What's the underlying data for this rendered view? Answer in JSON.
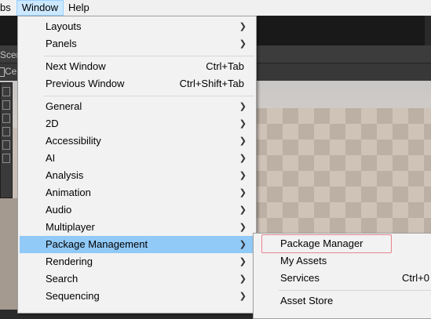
{
  "menubar": {
    "items": [
      {
        "label": "bs"
      },
      {
        "label": "Window"
      },
      {
        "label": "Help"
      }
    ]
  },
  "editor": {
    "scene_tab": "Scen",
    "subbar_text": "Ce"
  },
  "window_menu": {
    "items": [
      {
        "label": "Layouts",
        "submenu": true
      },
      {
        "label": "Panels",
        "submenu": true
      },
      {
        "label": "Next Window",
        "shortcut": "Ctrl+Tab"
      },
      {
        "label": "Previous Window",
        "shortcut": "Ctrl+Shift+Tab"
      },
      {
        "label": "General",
        "submenu": true
      },
      {
        "label": "2D",
        "submenu": true
      },
      {
        "label": "Accessibility",
        "submenu": true
      },
      {
        "label": "AI",
        "submenu": true
      },
      {
        "label": "Analysis",
        "submenu": true
      },
      {
        "label": "Animation",
        "submenu": true
      },
      {
        "label": "Audio",
        "submenu": true
      },
      {
        "label": "Multiplayer",
        "submenu": true
      },
      {
        "label": "Package Management",
        "submenu": true,
        "highlighted": true
      },
      {
        "label": "Rendering",
        "submenu": true
      },
      {
        "label": "Search",
        "submenu": true
      },
      {
        "label": "Sequencing",
        "submenu": true
      }
    ]
  },
  "package_submenu": {
    "items": [
      {
        "label": "Package Manager",
        "annotated": true
      },
      {
        "label": "My Assets"
      },
      {
        "label": "Services",
        "shortcut": "Ctrl+0"
      },
      {
        "label": "Asset Store"
      }
    ]
  },
  "icons": {
    "submenu_arrow": "chevron-right-icon"
  },
  "colors": {
    "highlight": "#91c9f7",
    "annotation": "#e8838e",
    "menubar_active": "#cce8ff"
  }
}
